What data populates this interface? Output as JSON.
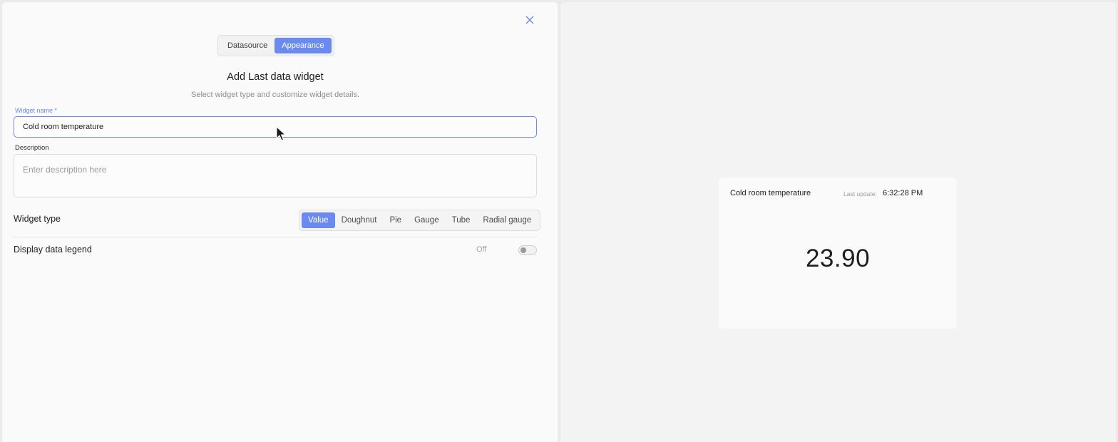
{
  "tabs": [
    {
      "label": "Datasource",
      "active": false
    },
    {
      "label": "Appearance",
      "active": true
    }
  ],
  "heading": "Add Last data widget",
  "subheading": "Select widget type and customize widget details.",
  "widget_name": {
    "label": "Widget name *",
    "value": "Cold room temperature"
  },
  "description": {
    "label": "Description",
    "placeholder": "Enter description here"
  },
  "widget_type": {
    "label": "Widget type",
    "options": [
      "Value",
      "Doughnut",
      "Pie",
      "Gauge",
      "Tube",
      "Radial gauge"
    ],
    "selected": "Value"
  },
  "legend": {
    "label": "Display data legend",
    "status": "Off"
  },
  "preview": {
    "title": "Cold room temperature",
    "update_label": "Last update:",
    "update_time": "6:32:28 PM",
    "value": "23.90"
  },
  "colors": {
    "accent": "#6b8af0"
  }
}
